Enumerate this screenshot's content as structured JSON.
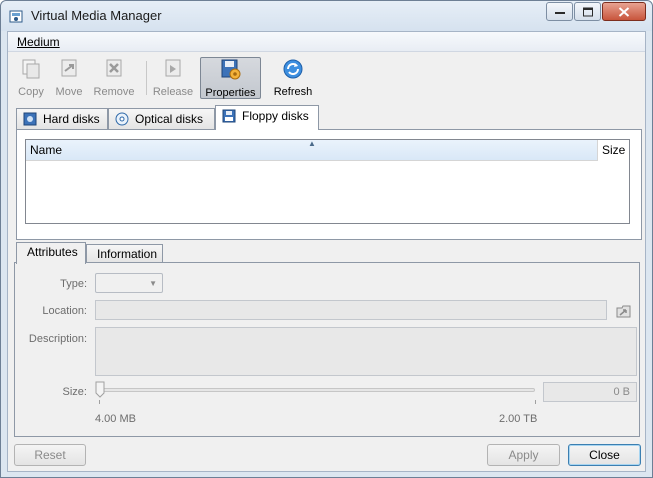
{
  "window": {
    "title": "Virtual Media Manager"
  },
  "menubar": {
    "items": [
      {
        "label": "Medium"
      }
    ]
  },
  "toolbar": {
    "copy": {
      "label": "Copy",
      "enabled": false
    },
    "move": {
      "label": "Move",
      "enabled": false
    },
    "remove": {
      "label": "Remove",
      "enabled": false
    },
    "release": {
      "label": "Release",
      "enabled": false
    },
    "properties": {
      "label": "Properties",
      "enabled": true,
      "pressed": true
    },
    "refresh": {
      "label": "Refresh",
      "enabled": true
    }
  },
  "media_tabs": {
    "items": [
      {
        "label": "Hard disks",
        "icon": "hard-disk-icon"
      },
      {
        "label": "Optical disks",
        "icon": "optical-disc-icon"
      },
      {
        "label": "Floppy disks",
        "icon": "floppy-disk-icon",
        "active": true
      }
    ]
  },
  "list": {
    "columns": [
      "Name",
      "Size"
    ],
    "rows": []
  },
  "details_tabs": {
    "items": [
      {
        "label": "Attributes",
        "active": true
      },
      {
        "label": "Information"
      }
    ]
  },
  "attributes": {
    "type_label": "Type:",
    "type_value": "",
    "location_label": "Location:",
    "location_value": "",
    "description_label": "Description:",
    "description_value": "",
    "size_label": "Size:",
    "size_value": "0 B",
    "size_min": "4.00 MB",
    "size_max": "2.00 TB",
    "slider_position": 0
  },
  "buttons": {
    "reset": "Reset",
    "apply": "Apply",
    "close": "Close"
  },
  "colors": {
    "accent": "#3c7fb1",
    "disabled_text": "#8a8a8a"
  }
}
